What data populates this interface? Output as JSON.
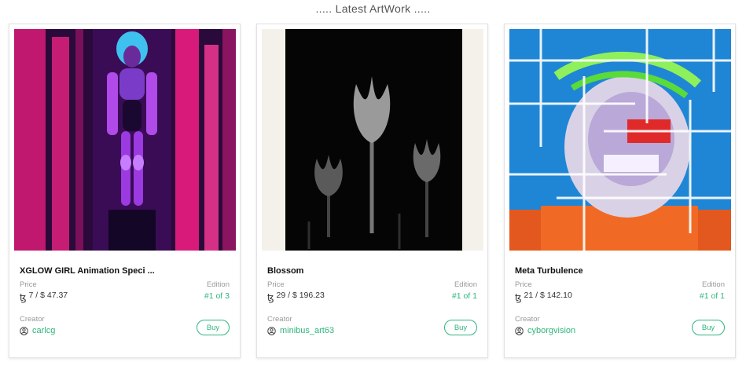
{
  "section": {
    "title": "..... Latest ArtWork ....."
  },
  "labels": {
    "price": "Price",
    "edition": "Edition",
    "creator": "Creator",
    "buy": "Buy",
    "currency_icon": "tezos-icon",
    "creator_icon": "user-icon"
  },
  "cards": [
    {
      "title": "XGLOW GIRL Animation Speci ...",
      "price": "7 / $ 47.37",
      "edition": "#1 of 3",
      "creator": "carlcg",
      "art": "neon-cyborg-girl"
    },
    {
      "title": "Blossom",
      "price": "29 / $ 196.23",
      "edition": "#1 of 1",
      "creator": "minibus_art63",
      "art": "dark-flowers"
    },
    {
      "title": "Meta Turbulence",
      "price": "21 / $ 142.10",
      "edition": "#1 of 1",
      "creator": "cyborgvision",
      "art": "glitch-portrait"
    }
  ],
  "colors": {
    "accent": "#2fb67c"
  }
}
